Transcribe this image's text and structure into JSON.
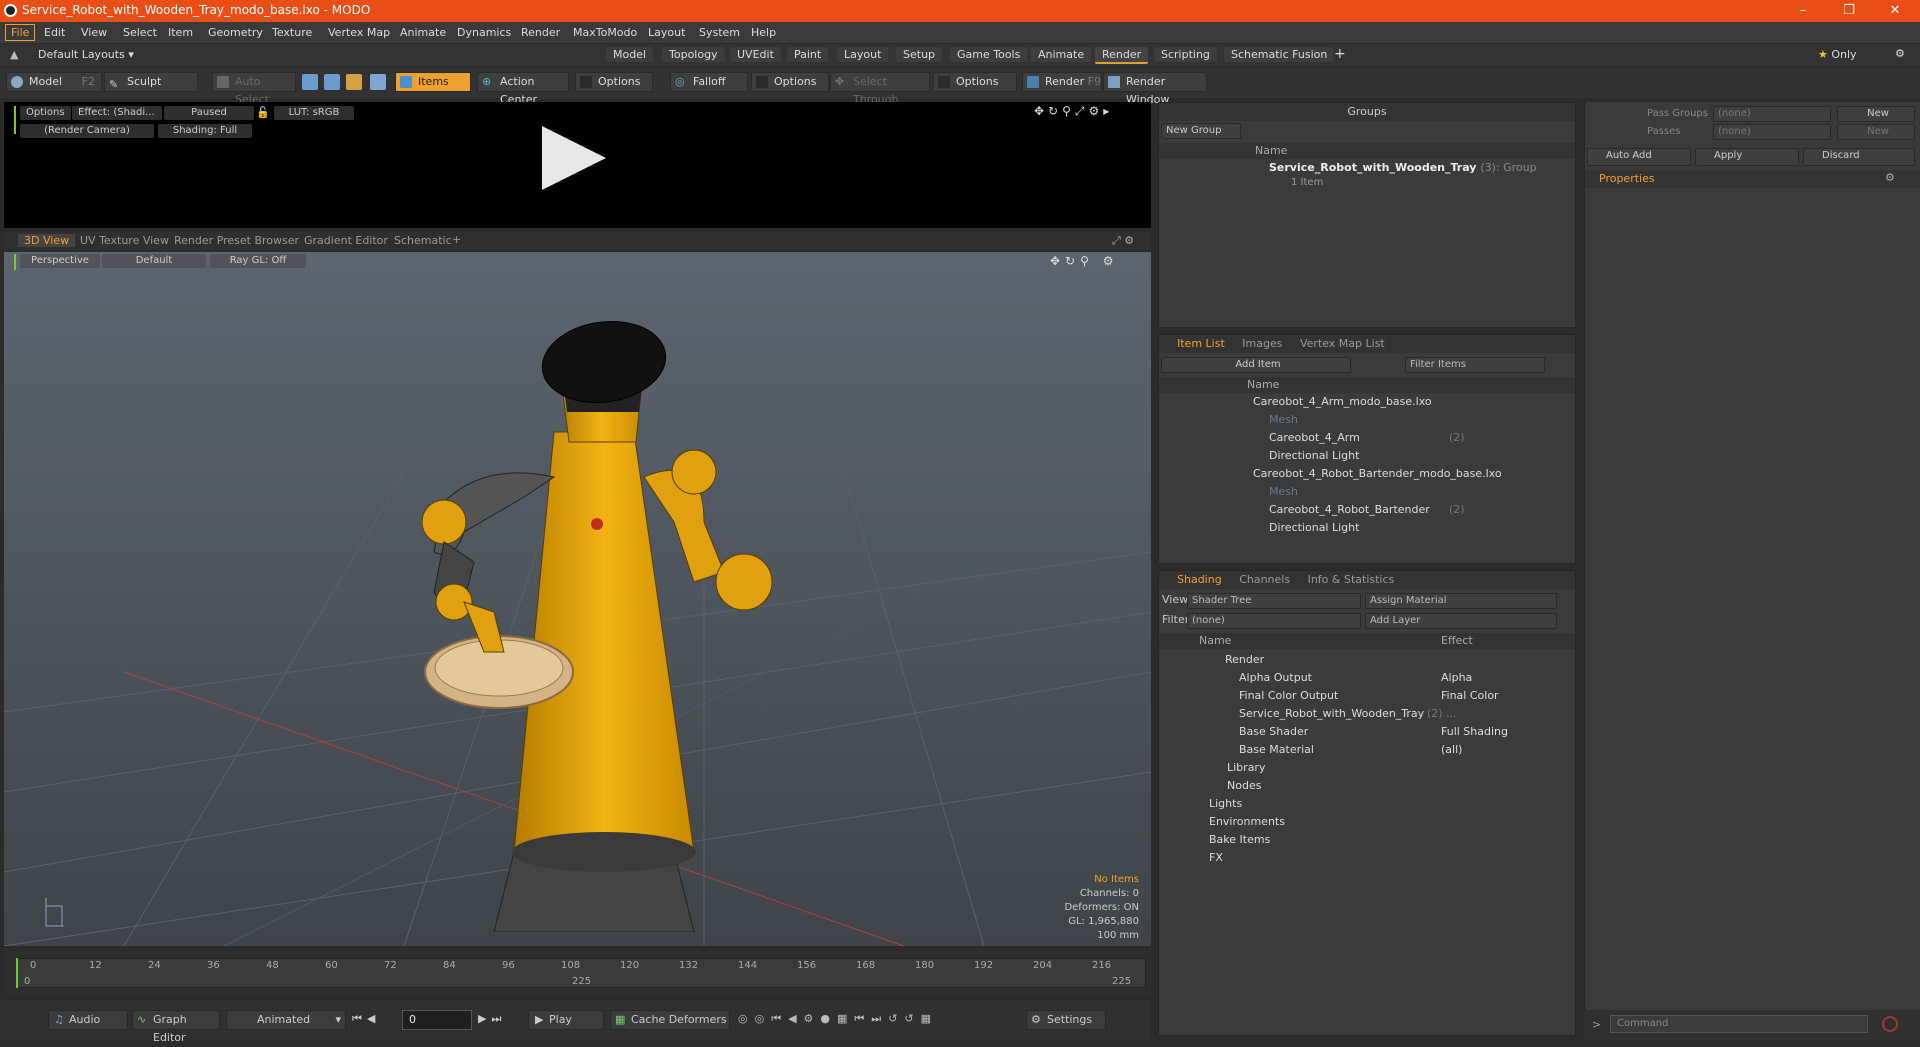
{
  "window": {
    "title": "Service_Robot_with_Wooden_Tray_modo_base.lxo - MODO"
  },
  "menubar": [
    "File",
    "Edit",
    "View",
    "Select",
    "Item",
    "Geometry",
    "Texture",
    "Vertex Map",
    "Animate",
    "Dynamics",
    "Render",
    "MaxToModo",
    "Layout",
    "System",
    "Help"
  ],
  "layoutbar": {
    "layouts": "Default Layouts",
    "tabs": [
      "Model",
      "Topology",
      "UVEdit",
      "Paint",
      "Layout",
      "Setup",
      "Game Tools",
      "Animate",
      "Render",
      "Scripting",
      "Schematic Fusion"
    ],
    "active": "Render",
    "only": "Only"
  },
  "toolbar": {
    "model": "Model",
    "model_key": "F2",
    "sculpt": "Sculpt",
    "auto_select": "Auto Select",
    "items": "Items",
    "action_center": "Action Center",
    "options1": "Options",
    "falloff": "Falloff",
    "options2": "Options",
    "select_through": "Select Through",
    "options3": "Options",
    "render": "Render",
    "render_key": "F9",
    "render_window": "Render Window"
  },
  "preview": {
    "options": "Options",
    "effect": "Effect: (Shadi...",
    "paused": "Paused",
    "lut": "LUT: sRGB",
    "camera": "(Render Camera)",
    "shading": "Shading: Full"
  },
  "viewtabs": [
    "3D View",
    "UV Texture View",
    "Render Preset Browser",
    "Gradient Editor",
    "Schematic"
  ],
  "viewport": {
    "perspective": "Perspective",
    "default": "Default",
    "raygl": "Ray GL: Off",
    "stats": {
      "no_items": "No Items",
      "channels": "Channels: 0",
      "deformers": "Deformers: ON",
      "gl": "GL: 1,965,880",
      "size": "100 mm"
    }
  },
  "timeline": {
    "ticks": [
      "0",
      "12",
      "24",
      "36",
      "48",
      "60",
      "72",
      "84",
      "96",
      "108",
      "120",
      "132",
      "144",
      "156",
      "168",
      "180",
      "192",
      "204",
      "216"
    ],
    "mid": "225",
    "end": "225",
    "start": "0"
  },
  "bottombar": {
    "audio": "Audio",
    "graph_editor": "Graph Editor",
    "animated": "Animated",
    "frame": "0",
    "play": "Play",
    "cache": "Cache Deformers",
    "settings": "Settings"
  },
  "groups": {
    "title": "Groups",
    "new_group": "New Group",
    "name_col": "Name",
    "item_name": "Service_Robot_with_Wooden_Tray",
    "item_count": "(3)",
    "item_type": ": Group",
    "item_sub": "1 Item"
  },
  "itemlist": {
    "tabs": [
      "Item List",
      "Images",
      "Vertex Map List"
    ],
    "add_item": "Add Item",
    "filter": "Filter Items",
    "name_col": "Name",
    "rows": [
      {
        "label": "Careobot_4_Arm_modo_base.lxo",
        "indent": 0,
        "dim": false,
        "count": ""
      },
      {
        "label": "Mesh",
        "indent": 1,
        "dim": true,
        "count": ""
      },
      {
        "label": "Careobot_4_Arm",
        "indent": 1,
        "dim": false,
        "count": "(2)"
      },
      {
        "label": "Directional Light",
        "indent": 1,
        "dim": false,
        "count": ""
      },
      {
        "label": "Careobot_4_Robot_Bartender_modo_base.lxo",
        "indent": 0,
        "dim": false,
        "count": ""
      },
      {
        "label": "Mesh",
        "indent": 1,
        "dim": true,
        "count": ""
      },
      {
        "label": "Careobot_4_Robot_Bartender",
        "indent": 1,
        "dim": false,
        "count": "(2)"
      },
      {
        "label": "Directional Light",
        "indent": 1,
        "dim": false,
        "count": ""
      }
    ]
  },
  "shading": {
    "tabs": [
      "Shading",
      "Channels",
      "Info & Statistics"
    ],
    "view_label": "View",
    "view_value": "Shader Tree",
    "assign": "Assign Material",
    "filter_label": "Filter",
    "filter_value": "(none)",
    "add_layer": "Add Layer",
    "name_col": "Name",
    "effect_col": "Effect",
    "rows": [
      {
        "label": "Render",
        "effect": ""
      },
      {
        "label": "Alpha Output",
        "effect": "Alpha"
      },
      {
        "label": "Final Color Output",
        "effect": "Final Color"
      },
      {
        "label": "Service_Robot_with_Wooden_Tray",
        "effect": "",
        "count": "(2) ..."
      },
      {
        "label": "Base Shader",
        "effect": "Full Shading"
      },
      {
        "label": "Base Material",
        "effect": "(all)"
      },
      {
        "label": "Library",
        "effect": ""
      },
      {
        "label": "Nodes",
        "effect": ""
      },
      {
        "label": "Lights",
        "effect": ""
      },
      {
        "label": "Environments",
        "effect": ""
      },
      {
        "label": "Bake Items",
        "effect": ""
      },
      {
        "label": "FX",
        "effect": ""
      }
    ]
  },
  "properties": {
    "pass_groups": "Pass Groups",
    "passes": "Passes",
    "none": "(none)",
    "new": "New",
    "auto_add": "Auto Add",
    "apply": "Apply",
    "discard": "Discard",
    "tab": "Properties"
  },
  "command": {
    "placeholder": "Command"
  }
}
